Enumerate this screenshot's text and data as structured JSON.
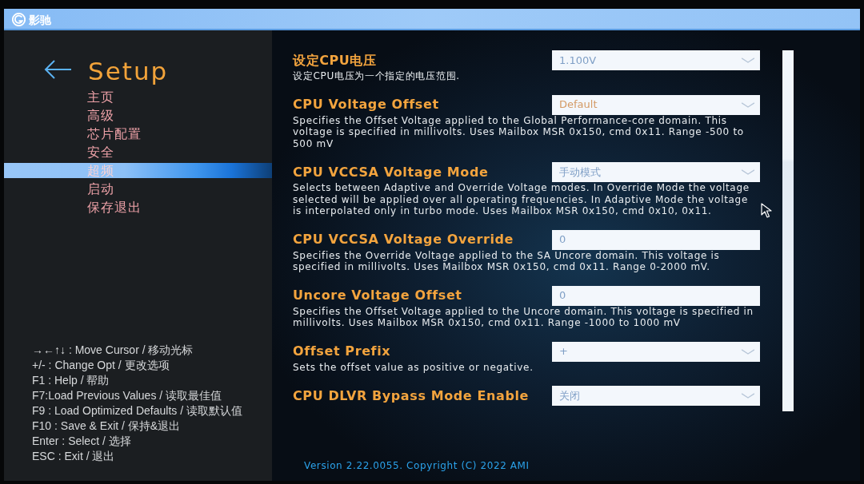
{
  "brand": {
    "logo_text": "影驰"
  },
  "sidebar": {
    "title": "Setup",
    "items": [
      {
        "label": "主页",
        "selected": false
      },
      {
        "label": "高级",
        "selected": false
      },
      {
        "label": "芯片配置",
        "selected": false
      },
      {
        "label": "安全",
        "selected": false
      },
      {
        "label": "超频",
        "selected": true
      },
      {
        "label": "启动",
        "selected": false
      },
      {
        "label": "保存退出",
        "selected": false
      }
    ],
    "help": [
      "→←↑↓ : Move Cursor / 移动光标",
      "+/- : Change Opt / 更改选项",
      "F1 : Help / 帮助",
      "F7:Load Previous Values / 读取最佳值",
      "F9 : Load Optimized Defaults / 读取默认值",
      "F10 : Save & Exit / 保持&退出",
      "Enter : Select / 选择",
      "ESC : Exit / 退出"
    ]
  },
  "settings": [
    {
      "title": "设定CPU电压",
      "description": "设定CPU电压为一个指定的电压范围.",
      "kind": "dropdown",
      "value": "1.100V",
      "color": "#7f9fc6"
    },
    {
      "title": "CPU Voltage Offset",
      "description": "Specifies the Offset Voltage applied to the Global Performance-core domain. This voltage is specified in millivolts. Uses Mailbox MSR 0x150, cmd 0x11. Range -500 to 500 mV",
      "kind": "dropdown",
      "value": "Default",
      "color": "#d49a64"
    },
    {
      "title": "CPU VCCSA Voltage Mode",
      "description": "Selects between Adaptive and Override Voltage modes. In Override Mode the voltage selected will be applied over all operating frequencies. In Adaptive Mode the voltage is interpolated only in turbo mode. Uses Mailbox MSR 0x150, cmd 0x10, 0x11.",
      "kind": "dropdown",
      "value": "手动模式",
      "color": "#7f9fc6"
    },
    {
      "title": "CPU VCCSA Voltage Override",
      "description": "Specifies the Override Voltage applied to the SA Uncore domain. This voltage is specified in millivolts. Uses Mailbox MSR 0x150, cmd 0x11. Range 0-2000 mV.",
      "kind": "number",
      "value": "0",
      "color": "#7f9fc6"
    },
    {
      "title": "Uncore Voltage Offset",
      "description": "Specifies the Offset Voltage applied to the Uncore domain. This voltage is specified in millivolts. Uses Mailbox MSR 0x150, cmd 0x11. Range -1000 to 1000 mV",
      "kind": "number",
      "value": "0",
      "color": "#7f9fc6"
    },
    {
      "title": "Offset Prefix",
      "description": "Sets the offset value as positive or negative.",
      "kind": "dropdown",
      "value": "+",
      "color": "#7f9fc6"
    },
    {
      "title": "CPU DLVR Bypass Mode Enable",
      "kind": "dropdown",
      "value": "关闭",
      "color": "#7f9fc6"
    }
  ],
  "footer": "Version 2.22.0055. Copyright (C) 2022 AMI"
}
